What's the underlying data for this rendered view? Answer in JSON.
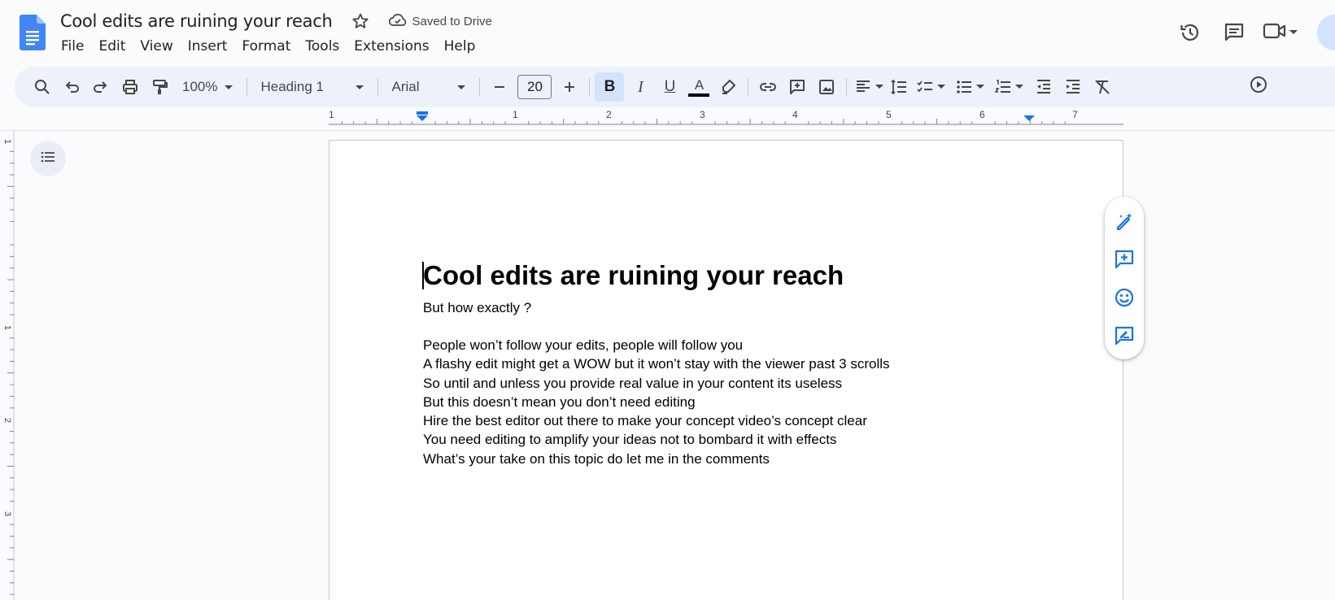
{
  "app": {
    "doc_title": "Cool edits are ruining your reach",
    "save_status": "Saved to Drive",
    "brand_color": "#4285f4",
    "accent_color": "#1a73e8"
  },
  "menu": [
    "File",
    "Edit",
    "View",
    "Insert",
    "Format",
    "Tools",
    "Extensions",
    "Help"
  ],
  "toolbar": {
    "zoom": "100%",
    "style": "Heading 1",
    "font": "Arial",
    "font_size": "20"
  },
  "ruler": {
    "labels": [
      "1",
      "1",
      "2",
      "3",
      "4",
      "5",
      "6",
      "7"
    ],
    "left_labels": [
      "1",
      "1",
      "2",
      "3"
    ]
  },
  "document": {
    "heading": "Cool edits are ruining your reach",
    "subheading": "But how exactly ?",
    "lines": [
      "People won’t follow your edits, people will follow you",
      "A flashy edit might get a WOW but it won’t stay with the viewer past 3 scrolls",
      "So until and unless you provide real value in your content its useless",
      "But this doesn’t mean you don’t need editing",
      "Hire the best editor out there to make your concept video’s concept clear",
      "You need editing to amplify your ideas not to bombard it with effects",
      "What’s your take on this topic do let me in the comments"
    ]
  }
}
